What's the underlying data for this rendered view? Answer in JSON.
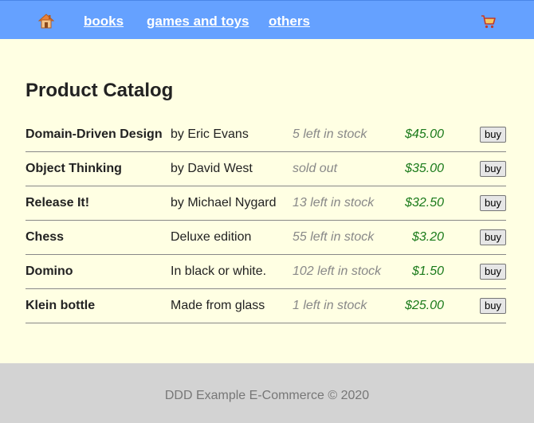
{
  "nav": {
    "home_icon": "house-icon",
    "links": [
      "books",
      "games and toys",
      "others"
    ],
    "cart_icon": "shopping-cart-icon"
  },
  "catalog": {
    "title": "Product Catalog",
    "buy_label": "buy",
    "products": [
      {
        "title": "Domain-Driven Design",
        "description": "by Eric Evans",
        "stock": "5 left in stock",
        "price": "$45.00"
      },
      {
        "title": "Object Thinking",
        "description": "by David West",
        "stock": "sold out",
        "price": "$35.00"
      },
      {
        "title": "Release It!",
        "description": "by Michael Nygard",
        "stock": "13 left in stock",
        "price": "$32.50"
      },
      {
        "title": "Chess",
        "description": "Deluxe edition",
        "stock": "55 left in stock",
        "price": "$3.20"
      },
      {
        "title": "Domino",
        "description": "In black or white.",
        "stock": "102 left in stock",
        "price": "$1.50"
      },
      {
        "title": "Klein bottle",
        "description": "Made from glass",
        "stock": "1 left in stock",
        "price": "$25.00"
      }
    ]
  },
  "footer": {
    "text": "DDD Example E-Commerce © 2020"
  },
  "colors": {
    "nav_background": "#65a1ff",
    "page_background": "#ffffe3",
    "price": "#1a7a1a",
    "stock": "#888888",
    "footer_background": "#d3d3d3"
  }
}
